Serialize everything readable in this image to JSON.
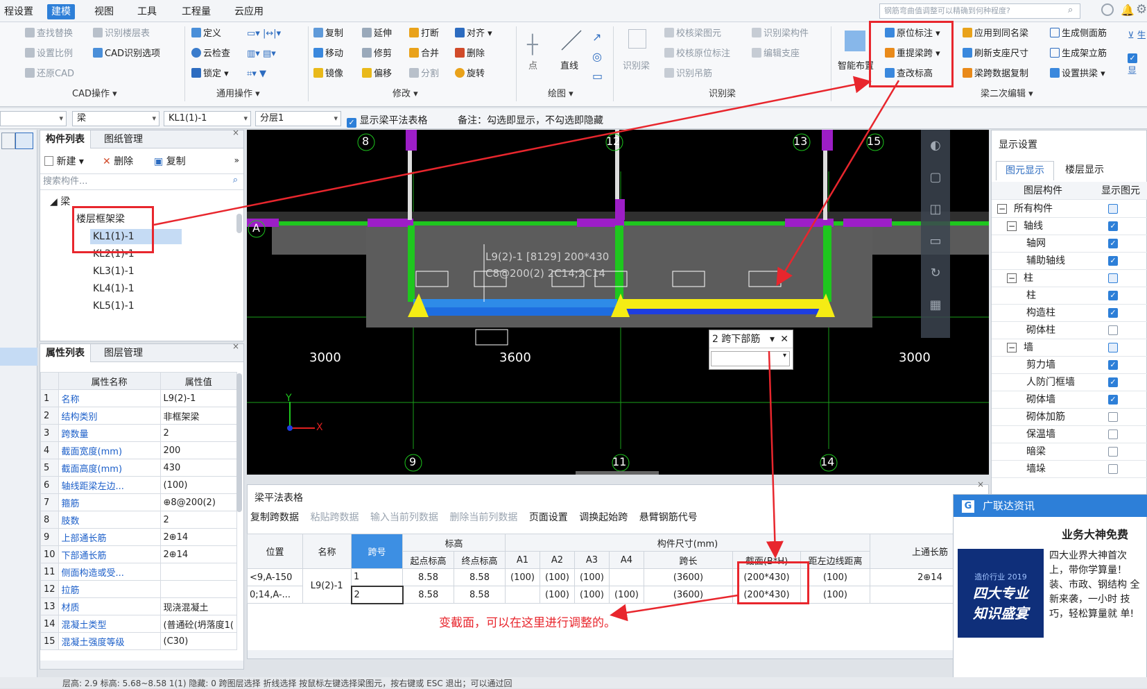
{
  "menu": {
    "items": [
      "程设置",
      "建模",
      "视图",
      "工具",
      "工程量",
      "云应用"
    ],
    "active": "建模",
    "search_placeholder": "钢筋弯曲值调整可以精确到何种程度?"
  },
  "ribbon": {
    "cad": {
      "items": [
        "查找替换",
        "识别楼层表",
        "设置比例",
        "CAD识别选项",
        "还原CAD"
      ],
      "label": "CAD操作"
    },
    "general": {
      "items": [
        "定义",
        "云检查",
        "锁定"
      ],
      "label": "通用操作"
    },
    "modify": {
      "items": [
        "复制",
        "延伸",
        "打断",
        "对齐",
        "移动",
        "修剪",
        "合并",
        "删除",
        "镜像",
        "偏移",
        "分割",
        "旋转"
      ],
      "label": "修改"
    },
    "draw": {
      "items": [
        "点",
        "直线"
      ],
      "label": "绘图"
    },
    "identify": {
      "items": [
        "识别梁",
        "校核梁图元",
        "识别梁构件",
        "校核原位标注",
        "编辑支座",
        "识别吊筋"
      ],
      "label": "识别梁"
    },
    "beam2": {
      "items": [
        "智能布置",
        "原位标注",
        "重提梁跨",
        "查改标高",
        "应用到同名梁",
        "刷新支座尺寸",
        "梁跨数据复制",
        "生成侧面筋",
        "生成架立筋",
        "设置拱梁"
      ],
      "label": "梁二次编辑"
    }
  },
  "toolbar2": {
    "dd_type": "梁",
    "dd_comp": "KL1(1)-1",
    "dd_layer": "分层1",
    "show_table": "显示梁平法表格",
    "note": "备注：勾选即显示，不勾选即隐藏"
  },
  "comp_panel": {
    "tabs": [
      "构件列表",
      "图纸管理"
    ],
    "new": "新建",
    "delete": "删除",
    "copy": "复制",
    "search": "搜索构件...",
    "root": "梁",
    "group": "楼层框架梁",
    "items": [
      "KL1(1)-1",
      "KL2(1)-1",
      "KL3(1)-1",
      "KL4(1)-1",
      "KL5(1)-1"
    ]
  },
  "prop_panel": {
    "tabs": [
      "属性列表",
      "图层管理"
    ],
    "headers": [
      "属性名称",
      "属性值"
    ],
    "rows": [
      [
        "1",
        "名称",
        "L9(2)-1"
      ],
      [
        "2",
        "结构类别",
        "非框架梁"
      ],
      [
        "3",
        "跨数量",
        "2"
      ],
      [
        "4",
        "截面宽度(mm)",
        "200"
      ],
      [
        "5",
        "截面高度(mm)",
        "430"
      ],
      [
        "6",
        "轴线距梁左边...",
        "(100)"
      ],
      [
        "7",
        "箍筋",
        "⊕8@200(2)"
      ],
      [
        "8",
        "肢数",
        "2"
      ],
      [
        "9",
        "上部通长筋",
        "2⊕14"
      ],
      [
        "10",
        "下部通长筋",
        "2⊕14"
      ],
      [
        "11",
        "侧面构造或受...",
        ""
      ],
      [
        "12",
        "拉筋",
        ""
      ],
      [
        "13",
        "材质",
        "现浇混凝土"
      ],
      [
        "14",
        "混凝土类型",
        "(普通砼(坍落度1("
      ],
      [
        "15",
        "混凝土强度等级",
        "(C30)"
      ]
    ]
  },
  "canvas": {
    "axis_top": [
      "8",
      "12",
      "13",
      "15"
    ],
    "axis_bottom": [
      "9",
      "11",
      "14"
    ],
    "axis_left": "A",
    "dims": [
      "3000",
      "3600",
      "3000"
    ],
    "beam_label1": "L9(2)-1 [8129] 200*430",
    "beam_label2": "C8@200(2) 2C14;2C14",
    "popup_title": "2 跨下部筋",
    "y": "Y",
    "x": "X"
  },
  "beam_table": {
    "title": "梁平法表格",
    "actions": [
      "复制跨数据",
      "粘贴跨数据",
      "输入当前列数据",
      "删除当前列数据",
      "页面设置",
      "调换起始跨",
      "悬臂钢筋代号"
    ],
    "h1": [
      "位置",
      "名称",
      "跨号",
      "标高",
      "构件尺寸(mm)",
      "上通长筋"
    ],
    "h2": [
      "起点标高",
      "终点标高",
      "A1",
      "A2",
      "A3",
      "A4",
      "跨长",
      "截面(B*H)",
      "距左边线距离"
    ],
    "rows": [
      [
        "<9,A-150",
        "L9(2)-1",
        "1",
        "8.58",
        "8.58",
        "(100)",
        "(100)",
        "(100)",
        "",
        "(3600)",
        "(200*430)",
        "(100)",
        "2⊕14"
      ],
      [
        "0;14,A-...",
        "",
        "2",
        "8.58",
        "8.58",
        "",
        "(100)",
        "(100)",
        "(100)",
        "(3600)",
        "(200*430)",
        "(100)",
        ""
      ]
    ]
  },
  "annotation": "变截面，可以在这里进行调整的。",
  "display": {
    "title": "显示设置",
    "tabs": [
      "图元显示",
      "楼层显示"
    ],
    "headers": [
      "图层构件",
      "显示图元"
    ],
    "rows": [
      [
        "所有构件",
        "g0",
        "part"
      ],
      [
        "轴线",
        "g1",
        "on"
      ],
      [
        "轴网",
        "i2",
        "on"
      ],
      [
        "辅助轴线",
        "i2",
        "on"
      ],
      [
        "柱",
        "g1",
        "part"
      ],
      [
        "柱",
        "i2",
        "on"
      ],
      [
        "构造柱",
        "i2",
        "on"
      ],
      [
        "砌体柱",
        "i2",
        "off"
      ],
      [
        "墙",
        "g1",
        "part"
      ],
      [
        "剪力墙",
        "i2",
        "on"
      ],
      [
        "人防门框墙",
        "i2",
        "on"
      ],
      [
        "砌体墙",
        "i2",
        "on"
      ],
      [
        "砌体加筋",
        "i2",
        "off"
      ],
      [
        "保温墙",
        "i2",
        "off"
      ],
      [
        "暗梁",
        "i2",
        "off"
      ],
      [
        "墙垛",
        "i2",
        "off"
      ]
    ]
  },
  "ad": {
    "title": "广联达资讯",
    "headline": "业务大神免费",
    "img_line1": "造价行业 2019",
    "img_line2": "四大专业",
    "img_line3": "知识盛宴",
    "body": "四大业界大神首次 上，带你学算量！ 装、市政、钢结构 全新来袭，一小时 技巧，轻松算量就 单!"
  },
  "status": {
    "text": "层高: 2.9    标高: 5.68~8.58    1(1)    隐藏: 0        跨图层选择  折线选择  按鼠标左键选择梁图元，按右键或 ESC 退出；可以通过回"
  }
}
